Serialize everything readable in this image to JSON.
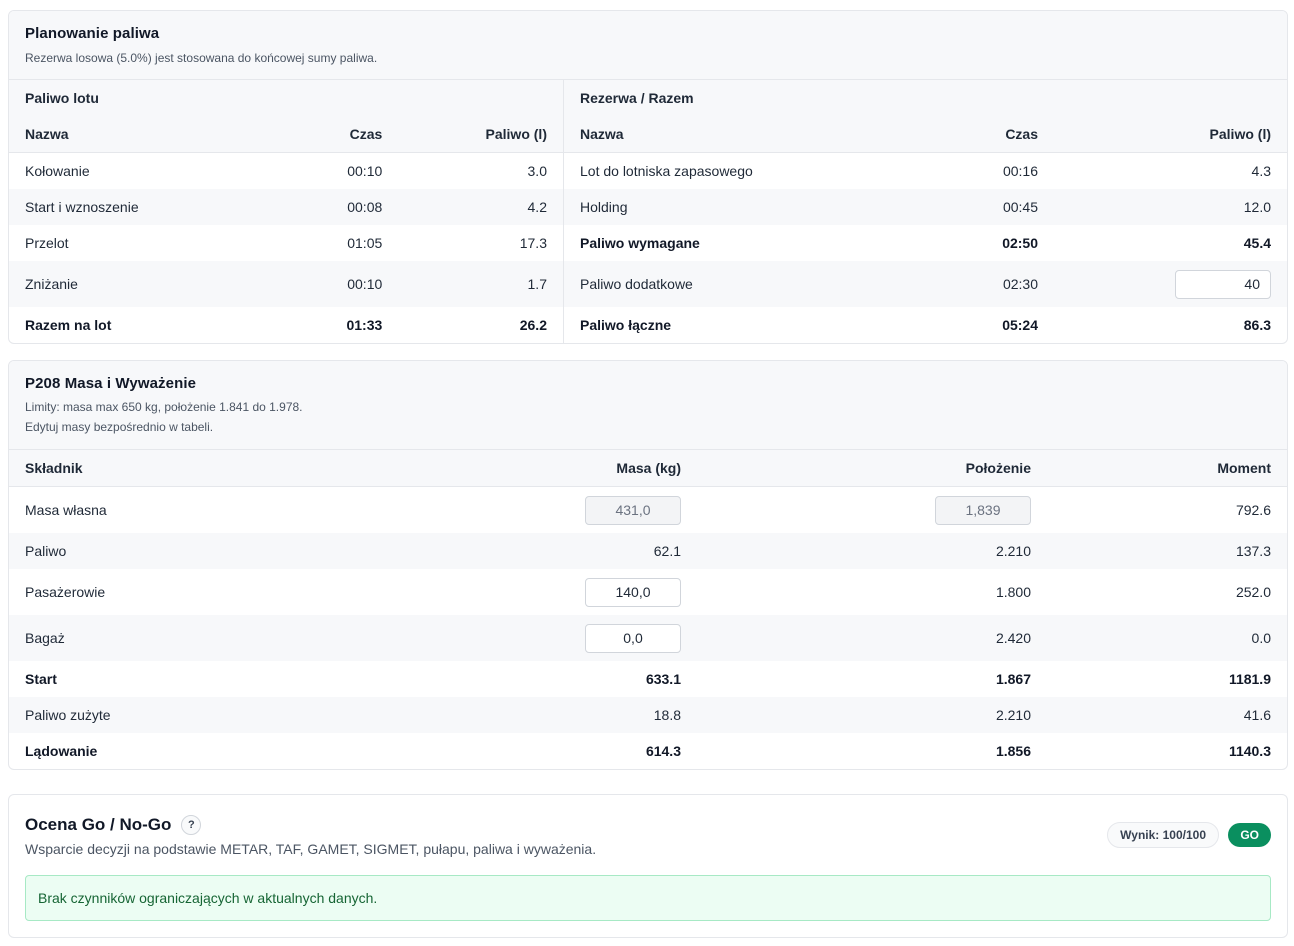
{
  "fuel": {
    "title": "Planowanie paliwa",
    "subtitle": "Rezerwa losowa (5.0%) jest stosowana do końcowej sumy paliwa.",
    "left": {
      "title": "Paliwo lotu",
      "headers": {
        "name": "Nazwa",
        "time": "Czas",
        "fuel": "Paliwo (l)"
      },
      "rows": [
        {
          "name": "Kołowanie",
          "time": "00:10",
          "fuel": "3.0"
        },
        {
          "name": "Start i wznoszenie",
          "time": "00:08",
          "fuel": "4.2"
        },
        {
          "name": "Przelot",
          "time": "01:05",
          "fuel": "17.3"
        },
        {
          "name": "Zniżanie",
          "time": "00:10",
          "fuel": "1.7"
        },
        {
          "name": "Razem na lot",
          "time": "01:33",
          "fuel": "26.2"
        }
      ]
    },
    "right": {
      "title": "Rezerwa / Razem",
      "headers": {
        "name": "Nazwa",
        "time": "Czas",
        "fuel": "Paliwo (l)"
      },
      "rows": [
        {
          "name": "Lot do lotniska zapasowego",
          "time": "00:16",
          "fuel": "4.3"
        },
        {
          "name": "Holding",
          "time": "00:45",
          "fuel": "12.0"
        },
        {
          "name": "Paliwo wymagane",
          "time": "02:50",
          "fuel": "45.4"
        },
        {
          "name": "Paliwo dodatkowe",
          "time": "02:30",
          "fuel": "40"
        },
        {
          "name": "Paliwo łączne",
          "time": "05:24",
          "fuel": "86.3"
        }
      ]
    }
  },
  "mass": {
    "title": "P208 Masa i Wyważenie",
    "subtitle1": "Limity: masa max 650 kg, położenie 1.841 do 1.978.",
    "subtitle2": "Edytuj masy bezpośrednio w tabeli.",
    "headers": {
      "name": "Składnik",
      "mass": "Masa (kg)",
      "pos": "Położenie",
      "moment": "Moment"
    },
    "rows": [
      {
        "name": "Masa własna",
        "mass": "431,0",
        "pos": "1,839",
        "moment": "792.6"
      },
      {
        "name": "Paliwo",
        "mass": "62.1",
        "pos": "2.210",
        "moment": "137.3"
      },
      {
        "name": "Pasażerowie",
        "mass": "140,0",
        "pos": "1.800",
        "moment": "252.0"
      },
      {
        "name": "Bagaż",
        "mass": "0,0",
        "pos": "2.420",
        "moment": "0.0"
      },
      {
        "name": "Start",
        "mass": "633.1",
        "pos": "1.867",
        "moment": "1181.9"
      },
      {
        "name": "Paliwo zużyte",
        "mass": "18.8",
        "pos": "2.210",
        "moment": "41.6"
      },
      {
        "name": "Lądowanie",
        "mass": "614.3",
        "pos": "1.856",
        "moment": "1140.3"
      }
    ]
  },
  "gonogo": {
    "title": "Ocena Go / No-Go",
    "help": "?",
    "subtitle": "Wsparcie decyzji na podstawie METAR, TAF, GAMET, SIGMET, pułapu, paliwa i wyważenia.",
    "score": "Wynik: 100/100",
    "decision": "GO",
    "message": "Brak czynników ograniczających w aktualnych danych."
  }
}
